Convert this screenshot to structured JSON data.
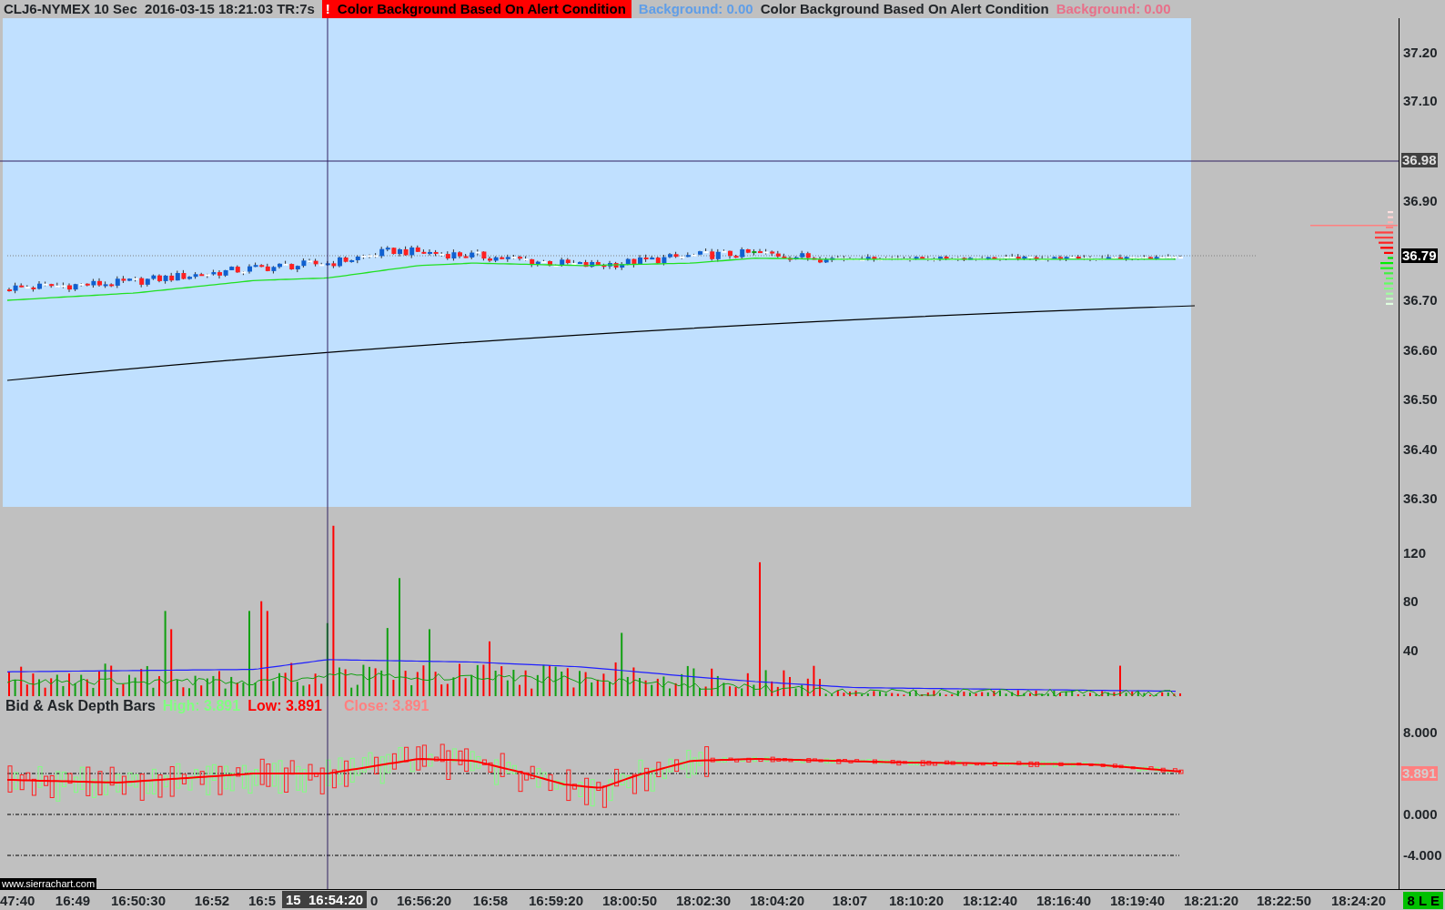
{
  "header": {
    "symbol": "CLJ6-NYMEX 10 Sec  2016-03-15 18:21:03 TR:7s",
    "alert_icon": "!",
    "studies": [
      {
        "name": "Color Background Based On Alert Condition",
        "value": "Background: 0.00",
        "alert": true,
        "color": "#5f9ee8"
      },
      {
        "name": "Color Background Based On Alert Condition",
        "value": "Background: 0.00",
        "alert": false,
        "color": "#e8708a"
      }
    ]
  },
  "price_axis": {
    "ticks": [
      "37.20",
      "37.10",
      "36.90",
      "36.70",
      "36.60",
      "36.50",
      "36.40",
      "36.30"
    ],
    "markers": [
      {
        "label": "36.98",
        "kind": "crosshair"
      },
      {
        "label": "36.79",
        "kind": "last"
      }
    ]
  },
  "volume_axis": {
    "ticks": [
      "120",
      "80",
      "40"
    ]
  },
  "indicator": {
    "title": "Bid & Ask Depth Bars",
    "values": [
      {
        "label": "High: 3.891",
        "color": "#80ff80"
      },
      {
        "label": "Low: 3.891",
        "color": "#ff0000"
      },
      {
        "label": "Close: 3.891",
        "color": "#ff8080"
      }
    ]
  },
  "indicator_axis": {
    "ticks": [
      "8.000",
      "0.000",
      "-4.000"
    ],
    "marker": "3.891"
  },
  "site_label": "www.sierrachart.com",
  "time_axis": {
    "labels": [
      "47:40",
      "16:49",
      "16:50:30",
      "16:52",
      "16:5",
      "0",
      "16:56:20",
      "16:58",
      "16:59:20",
      "18:00:50",
      "18:02:30",
      "18:04:20",
      "18:07",
      "18:10:20",
      "18:12:40",
      "18:16:40",
      "18:19:40",
      "18:21:20",
      "18:22:50",
      "18:24:20"
    ],
    "crosshair_label": "15  16:54:20"
  },
  "status": "8 L E"
}
